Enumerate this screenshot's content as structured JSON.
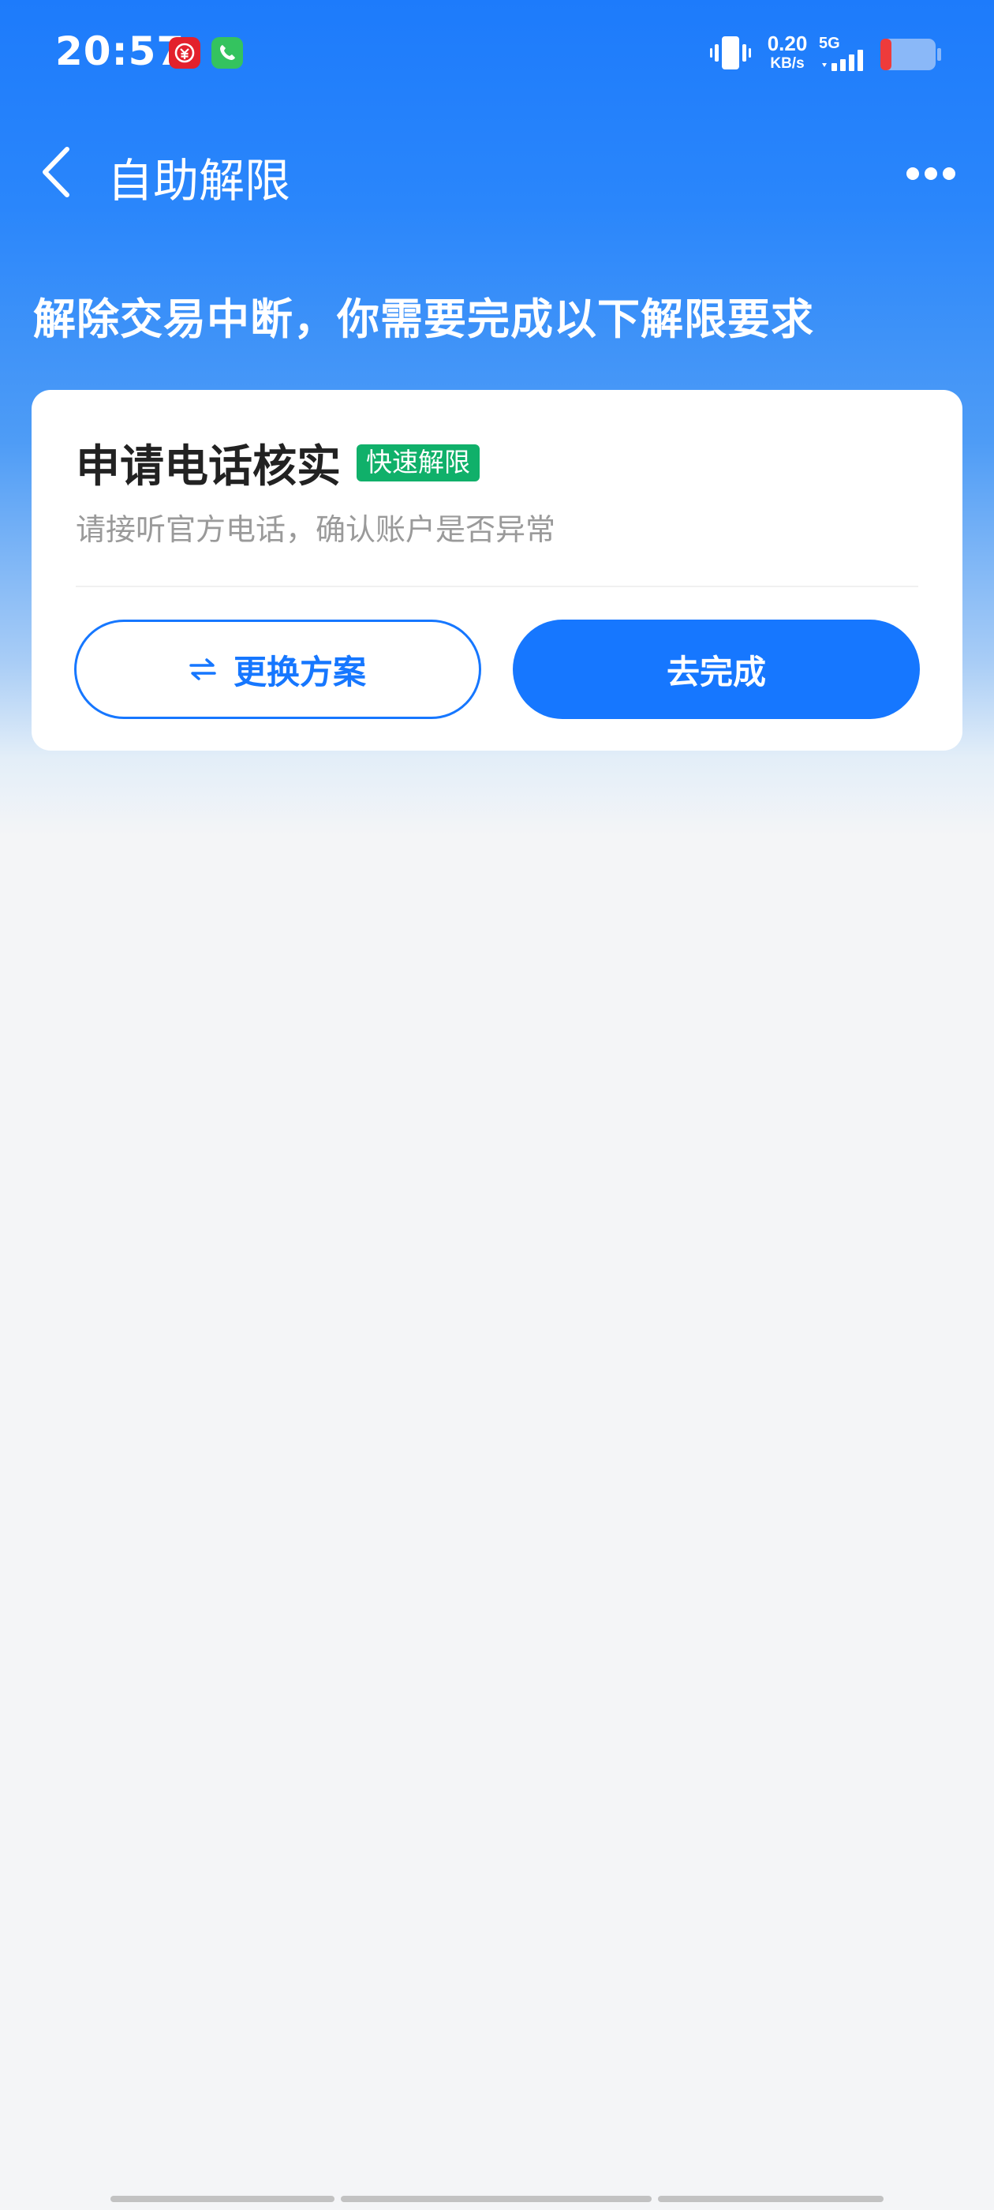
{
  "status_bar": {
    "time": "20:57",
    "net_speed_value": "0.20",
    "net_speed_unit": "KB/s",
    "network_type": "5G",
    "icons": [
      "bank-app-icon",
      "phone-app-icon",
      "vibrate-icon",
      "signal-icon",
      "battery-icon"
    ]
  },
  "nav": {
    "title": "自助解限",
    "back_icon": "chevron-left-icon",
    "more_icon": "more-horizontal-icon"
  },
  "heading": "解除交易中断，你需要完成以下解限要求",
  "card": {
    "title": "申请电话核实",
    "tag": "快速解限",
    "description": "请接听官方电话，确认账户是否异常",
    "change_button_label": "更换方案",
    "change_button_icon": "swap-icon",
    "complete_button_label": "去完成"
  },
  "colors": {
    "primary": "#1677ff",
    "tag_green": "#10b06a",
    "page_bg": "#f4f5f7"
  }
}
